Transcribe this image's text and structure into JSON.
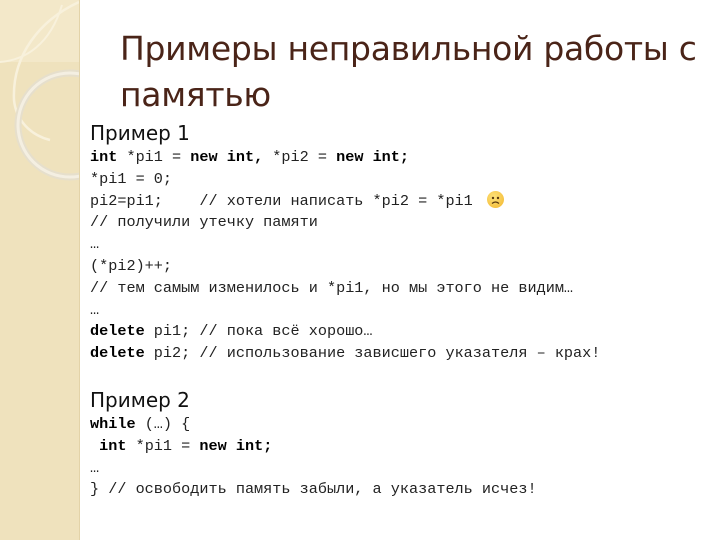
{
  "slide": {
    "title": "Примеры неправильной работы с памятью",
    "accent_colors": {
      "title": "#4a2418",
      "strip": "#efe2bd"
    }
  },
  "example1": {
    "heading": "Пример 1",
    "lines": [
      [
        {
          "t": "int",
          "kw": true
        },
        {
          "t": " *pi1 = "
        },
        {
          "t": "new int,",
          "kw": true
        },
        {
          "t": " *pi2 = "
        },
        {
          "t": "new int;",
          "kw": true
        }
      ],
      [
        {
          "t": "*pi1 = 0;"
        }
      ],
      [
        {
          "t": "pi2=pi1;    // хотели написать *pi2 = *pi1"
        },
        {
          "icon": "frowning-face-icon"
        }
      ],
      [
        {
          "t": "// получили утечку памяти"
        }
      ],
      [
        {
          "t": "…"
        }
      ],
      [
        {
          "t": "(*pi2)++;"
        }
      ],
      [
        {
          "t": "// тем самым изменилось и *pi1, но мы этого не видим…"
        }
      ],
      [
        {
          "t": "…"
        }
      ],
      [
        {
          "t": "delete",
          "kw": true
        },
        {
          "t": " pi1; // пока всё хорошо…"
        }
      ],
      [
        {
          "t": "delete",
          "kw": true
        },
        {
          "t": " pi2; // использование зависшего указателя – крах!"
        }
      ]
    ]
  },
  "example2": {
    "heading": "Пример 2",
    "lines": [
      [
        {
          "t": "while",
          "kw": true
        },
        {
          "t": " (…) {"
        }
      ],
      [
        {
          "t": " "
        },
        {
          "t": "int",
          "kw": true
        },
        {
          "t": " *pi1 = "
        },
        {
          "t": "new int;",
          "kw": true
        }
      ],
      [
        {
          "t": "…"
        }
      ],
      [
        {
          "t": "} // освободить память забыли, а указатель исчез!"
        }
      ]
    ]
  }
}
